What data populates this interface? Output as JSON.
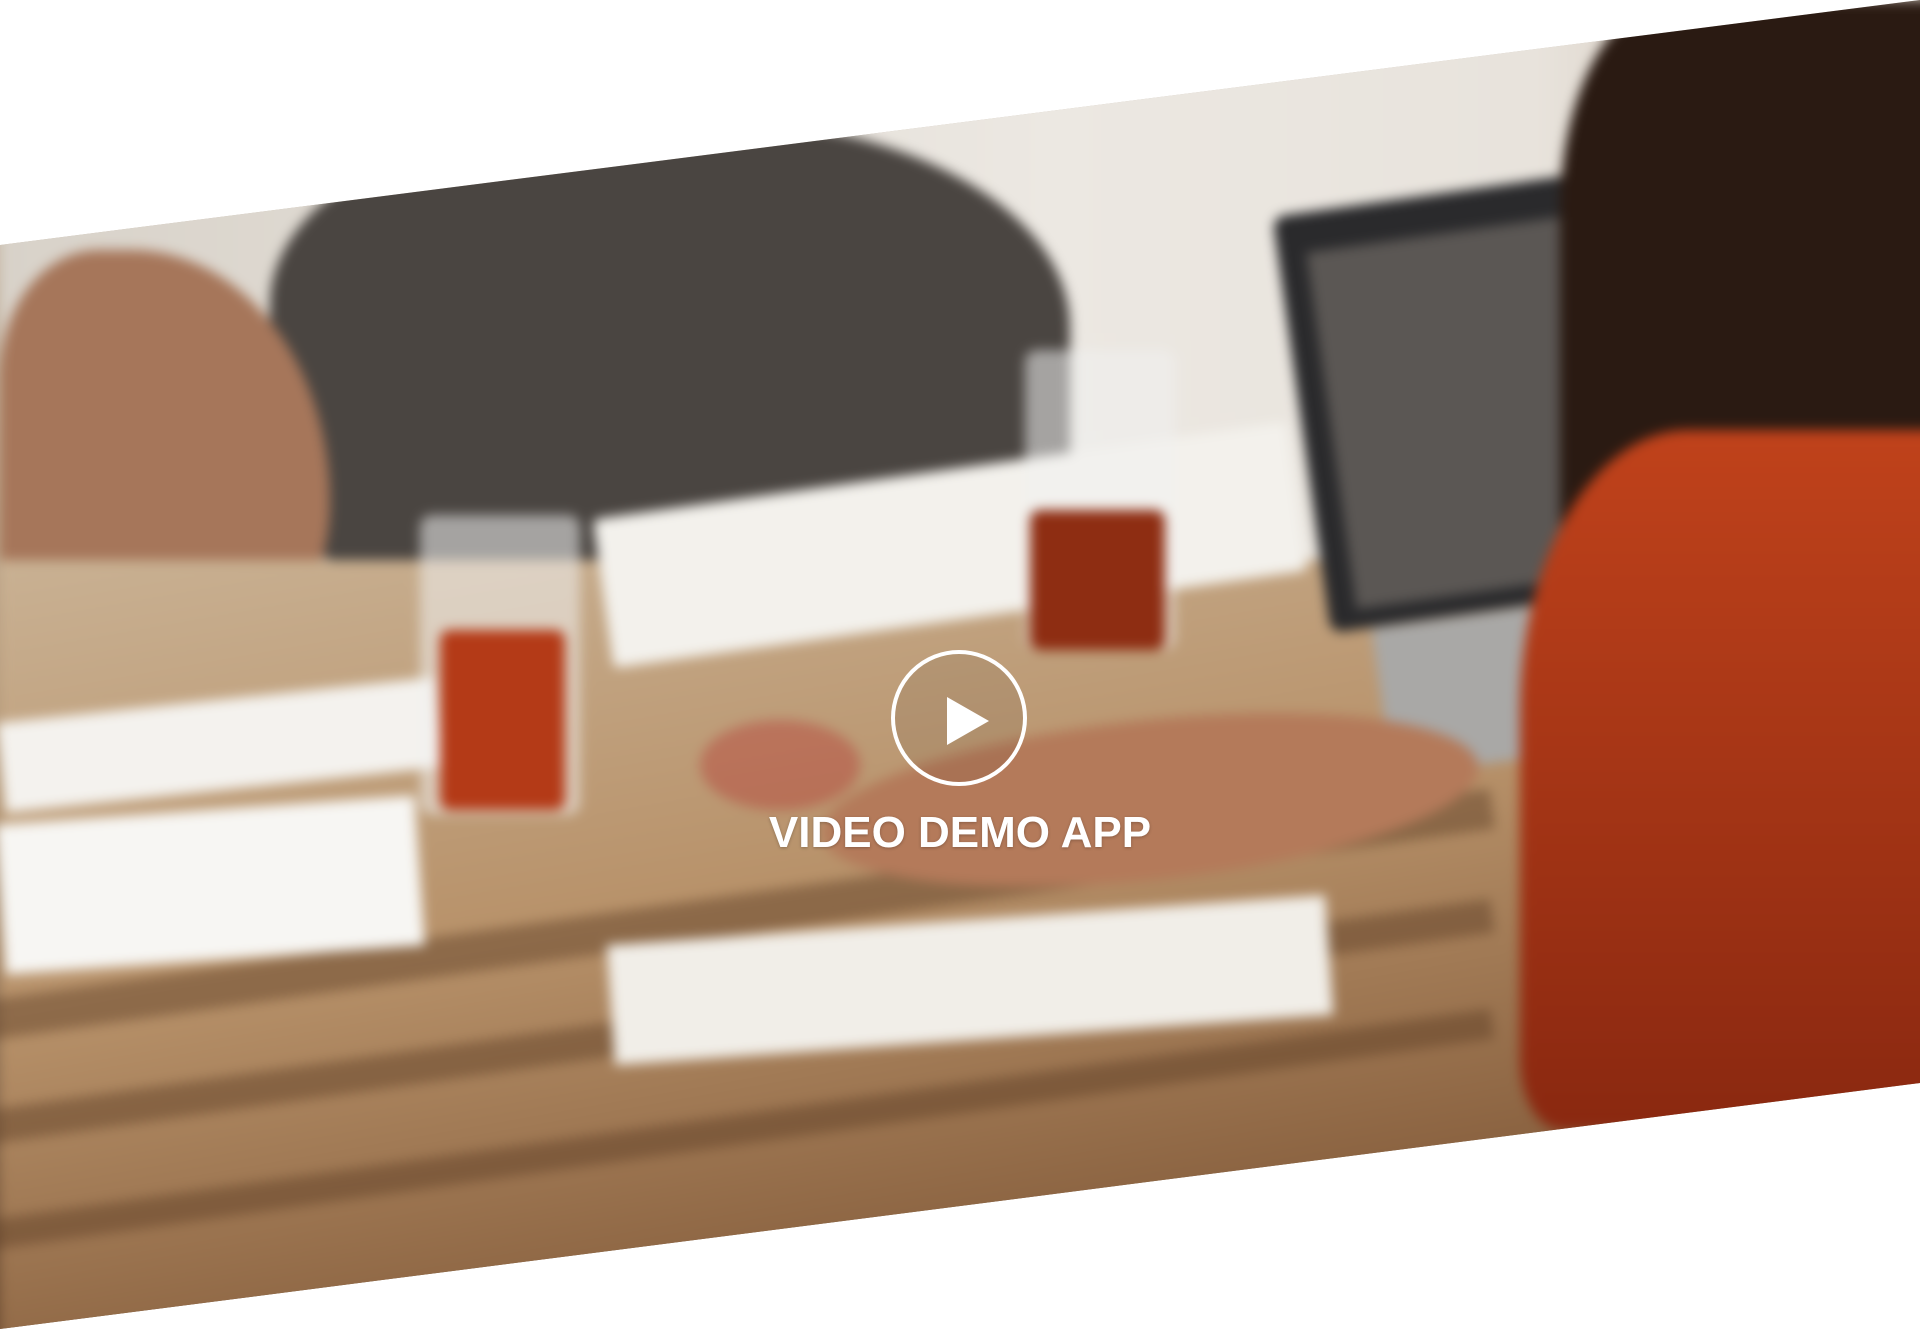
{
  "video_section": {
    "title": "VIDEO DEMO APP",
    "play_icon": "play-icon",
    "background_image": "blurred-team-meeting-photo"
  },
  "colors": {
    "text": "#ffffff",
    "page_background": "#ffffff"
  }
}
